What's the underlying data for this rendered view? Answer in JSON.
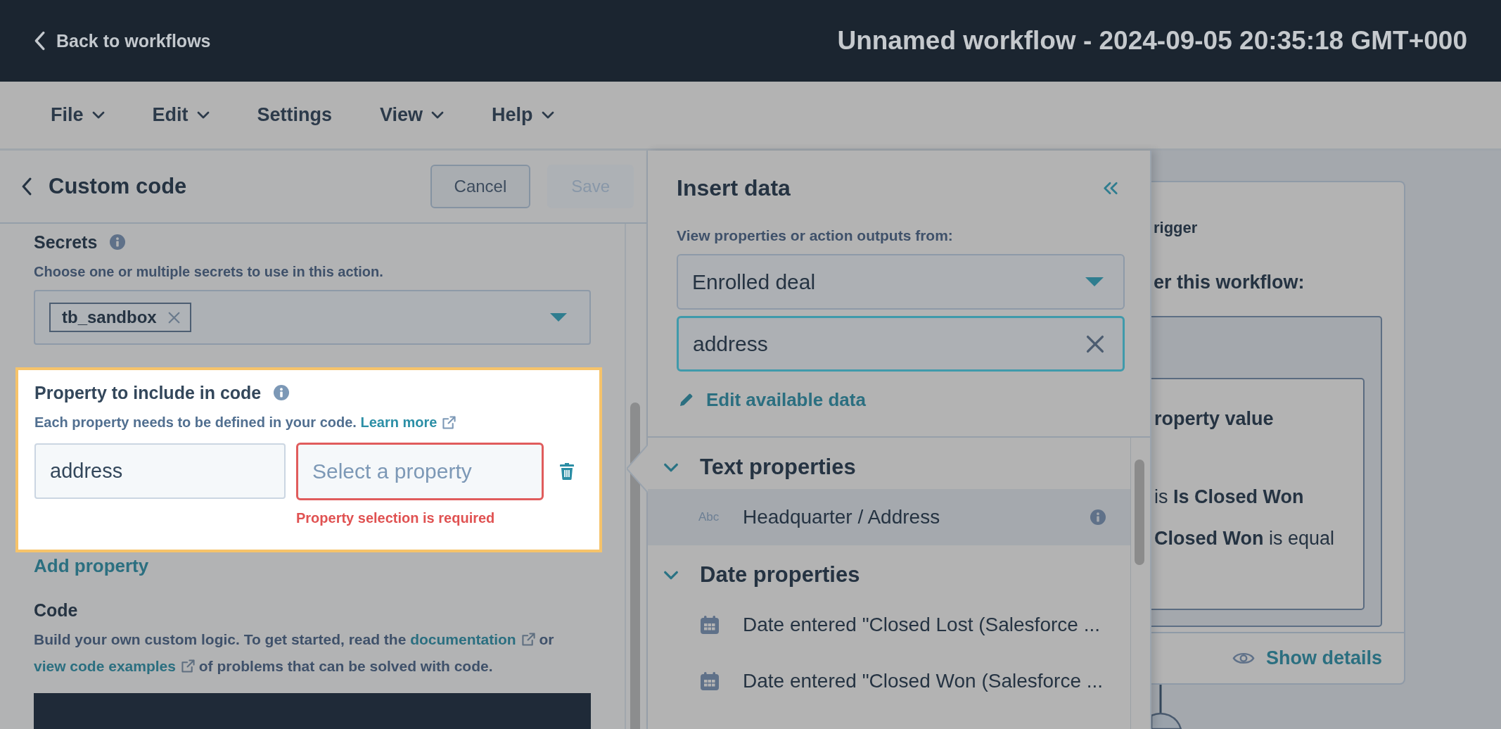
{
  "top_bar": {
    "back_link": "Back to workflows",
    "title": "Unnamed workflow - 2024-09-05 20:35:18 GMT+000"
  },
  "menu_bar": {
    "items": [
      {
        "label": "File",
        "kind": "dropdown"
      },
      {
        "label": "Edit",
        "kind": "dropdown"
      },
      {
        "label": "Settings",
        "kind": "plain"
      },
      {
        "label": "View",
        "kind": "dropdown"
      },
      {
        "label": "Help",
        "kind": "dropdown"
      }
    ]
  },
  "action_panel": {
    "title": "Custom code",
    "buttons": [
      {
        "label": "Cancel",
        "disabled": false
      },
      {
        "label": "Save",
        "disabled": true
      }
    ],
    "secrets": {
      "label": "Secrets",
      "help": "Choose one or multiple secrets to use in this action.",
      "tags": [
        "tb_sandbox"
      ]
    },
    "properties": {
      "label": "Property to include in code",
      "help": "Each property needs to be defined in your code.",
      "link": "Learn more",
      "highlighted": true,
      "rows": [
        {
          "name": "address",
          "placeholder": "Select a property",
          "error": "Property selection is required"
        }
      ]
    },
    "add_property": "Add property",
    "code": {
      "label": "Code",
      "description": [
        {
          "kind": "text",
          "text": "Build your own custom logic. To get started, read the "
        },
        {
          "kind": "link",
          "text": "documentation"
        },
        {
          "kind": "text",
          "text": " or "
        },
        {
          "kind": "link",
          "text": "view code examples"
        },
        {
          "kind": "text",
          "text": " of problems that can be solved with code."
        }
      ]
    }
  },
  "insert_panel": {
    "title": "Insert data",
    "source_label": "View properties or action outputs from:",
    "source": "Enrolled deal",
    "search": {
      "value": "address"
    },
    "edit_link": "Edit available data",
    "groups": [
      {
        "title": "Text properties",
        "expanded": true,
        "items": [
          {
            "kind": "text",
            "type_label": "Abc",
            "label": "Headquarter / Address",
            "selected": true
          }
        ]
      },
      {
        "title": "Date properties",
        "expanded": true,
        "items": [
          {
            "kind": "date",
            "label": "Date entered \"Closed Lost (Salesforce ...",
            "selected": false
          },
          {
            "kind": "date",
            "label": "Date entered \"Closed Won (Salesforce ...",
            "selected": false
          }
        ]
      }
    ]
  },
  "canvas": {
    "trigger_card": {
      "heading": "rigger",
      "subheading": "er this workflow:",
      "filter": {
        "title": "roperty value",
        "lines": [
          "is **Is Closed Won**",
          "**Closed Won** is equal"
        ]
      },
      "footer_link": "Show details"
    }
  }
}
